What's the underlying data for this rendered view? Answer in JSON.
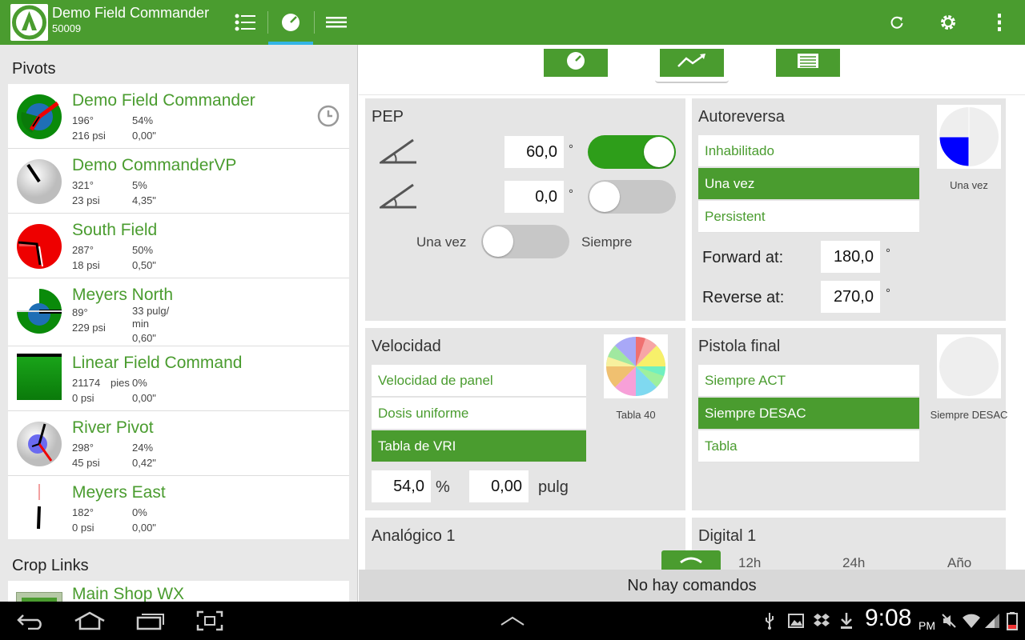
{
  "header": {
    "title": "Demo Field Commander",
    "subtitle": "50009",
    "icons": [
      "list-icon",
      "pivot-view-icon",
      "menu-icon",
      "refresh-icon",
      "settings-icon",
      "overflow-icon"
    ]
  },
  "sidebar": {
    "pivots_heading": "Pivots",
    "pivots": [
      {
        "name": "Demo Field Commander",
        "angle": "196°",
        "pct": "54%",
        "pressure": "216 psi",
        "depth": "0,00\"",
        "status_icon": "clock-icon"
      },
      {
        "name": "Demo CommanderVP",
        "angle": "321°",
        "pct": "5%",
        "pressure": "23 psi",
        "depth": "4,35\""
      },
      {
        "name": "South Field",
        "angle": "287°",
        "pct": "50%",
        "pressure": "18 psi",
        "depth": "0,50\""
      },
      {
        "name": "Meyers North",
        "angle": "89°",
        "pct": "33 pulg/\nmin",
        "pressure": "229 psi",
        "depth": "0,60\""
      },
      {
        "name": "Linear Field Command",
        "angle": "21174",
        "unit": "pies",
        "pct": "0%",
        "pressure": "0 psi",
        "depth": "0,00\""
      },
      {
        "name": "River Pivot",
        "angle": "298°",
        "pct": "24%",
        "pressure": "45 psi",
        "depth": "0,42\""
      },
      {
        "name": "Meyers East",
        "angle": "182°",
        "pct": "0%",
        "pressure": "0 psi",
        "depth": "0,00\""
      }
    ],
    "crop_heading": "Crop Links",
    "crop_links": [
      {
        "name": "Main Shop WX"
      }
    ]
  },
  "subtabs": [
    "pie-icon",
    "trend-icon",
    "table-icon"
  ],
  "pep": {
    "title": "PEP",
    "row1_value": "60,0",
    "row1_unit": "°",
    "row1_on": true,
    "row2_value": "0,0",
    "row2_unit": "°",
    "row2_on": false,
    "left_label": "Una vez",
    "right_label": "Siempre",
    "mode_on": false
  },
  "autoreversa": {
    "title": "Autoreversa",
    "options": [
      "Inhabilitado",
      "Una vez",
      "Persistent"
    ],
    "selected": 1,
    "forward_label": "Forward at:",
    "forward_value": "180,0",
    "reverse_label": "Reverse at:",
    "reverse_value": "270,0",
    "unit": "°",
    "caption": "Una vez"
  },
  "velocidad": {
    "title": "Velocidad",
    "options": [
      "Velocidad de panel",
      "Dosis uniforme",
      "Tabla de VRI"
    ],
    "selected": 2,
    "percent_value": "54,0",
    "percent_unit": "%",
    "depth_value": "0,00",
    "depth_unit": "pulg",
    "caption": "Tabla 40"
  },
  "pistola": {
    "title": "Pistola final",
    "options": [
      "Siempre ACT",
      "Siempre DESAC",
      "Tabla"
    ],
    "selected": 1,
    "caption": "Siempre DESAC"
  },
  "analogico": {
    "title": "Analógico 1"
  },
  "digital": {
    "title": "Digital 1",
    "ranges": [
      "12h",
      "24h",
      "Año"
    ]
  },
  "status": {
    "no_commands": "No hay comandos"
  },
  "system": {
    "time": "9:08",
    "ampm": "PM"
  },
  "colors": {
    "brand": "#4a9c2f",
    "accent": "#33b5e5",
    "toggle_on": "#2e9e1a"
  }
}
